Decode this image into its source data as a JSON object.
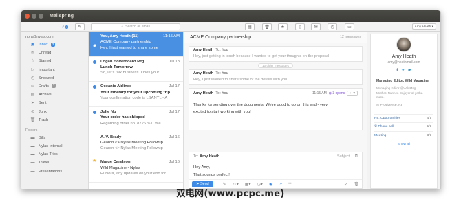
{
  "window": {
    "title": "Mailspring"
  },
  "toolbar": {
    "search_placeholder": "Search all email",
    "compose_badge": "1",
    "account_button": "Amy Heath"
  },
  "sidebar": {
    "account": "nora@nylas.com",
    "items": [
      {
        "label": "Inbox",
        "icon": "inbox-icon",
        "badge": "3",
        "active": true
      },
      {
        "label": "Unread",
        "icon": "unread-icon"
      },
      {
        "label": "Starred",
        "icon": "star-icon"
      },
      {
        "label": "Important",
        "icon": "important-icon"
      },
      {
        "label": "Snoozed",
        "icon": "clock-icon"
      },
      {
        "label": "Drafts",
        "icon": "draft-icon",
        "badge": "2"
      },
      {
        "label": "Archive",
        "icon": "archive-icon"
      },
      {
        "label": "Sent",
        "icon": "sent-icon"
      },
      {
        "label": "Junk",
        "icon": "junk-icon"
      },
      {
        "label": "Trash",
        "icon": "trash-icon"
      }
    ],
    "folders_label": "Folders",
    "folders": [
      "Bills",
      "Nylas-Internal",
      "Nylas Trips",
      "Travel",
      "Presentations"
    ]
  },
  "messages": [
    {
      "from": "You, Amy Heath (11)",
      "date": "11:15 AM",
      "subject": "ACME Company partnership",
      "snippet": "Hey, I just wanted to share some",
      "selected": true
    },
    {
      "from": "Logan Hoverboard Mfg.",
      "date": "Jul 18",
      "subject": "Lunch Tomorrow",
      "snippet": "So, let's talk business. Does your",
      "unread": true
    },
    {
      "from": "Oceanic Airlines",
      "date": "Jul 17",
      "subject": "Your itinerary for your upcoming trip",
      "snippet": "Your confirmation code is LSANYL - A",
      "unread": true
    },
    {
      "from": "Julie Ng",
      "date": "Jul 17",
      "subject": "Your order has shipped",
      "snippet": "Regarding order no. 8726761: We",
      "unread": true
    },
    {
      "from": "A. V. Brady",
      "date": "Jul 16",
      "subject": "Gearon <> Nylas Meeting Followup",
      "snippet": "Gearon <> Nylas Meeting Followup"
    },
    {
      "from": "Marge Carelson",
      "date": "Jul 16",
      "subject": "Wild Magazine - Nylas",
      "snippet": "Hi Nora, any updates on your end for",
      "starred": true
    }
  ],
  "thread": {
    "subject": "ACME Company partnership",
    "count": "12 messages",
    "first": {
      "from": "Amy Heath",
      "to": "To: You",
      "snippet": "Hey, just getting in touch because I wanted to get your thoughts on the proposal"
    },
    "older_label": "10 older messages",
    "second": {
      "from": "Amy Heath",
      "to": "To: You",
      "snippet": "Hey, I just wanted to share some of the details with you..."
    },
    "open": {
      "from": "Amy Heath",
      "to": "To: You",
      "time": "11:15 AM",
      "opens": "3 opens",
      "body1": "Thanks for sending over the documents. We're good to go on this end - very",
      "body2": "excited to start working with you!"
    }
  },
  "reply": {
    "to_label": "To:",
    "to": "Amy Heath",
    "subject_label": "Subject",
    "line1": "Hey Amy,",
    "line2": "That sounds perfect!",
    "send": "Send"
  },
  "contact": {
    "name": "Amy Heath",
    "email": "amy@heathmail.com",
    "title": "Managing Editor, Wild Magazine",
    "bio1": "Managing Editor @WildMag.",
    "bio2": "Mother. Runner. Enjoyer of yerba mate.",
    "location": "Providence, RI",
    "threads": [
      {
        "label": "Re: Opportunities",
        "value": "4/7"
      },
      {
        "label": "Phone call",
        "value": "5/7"
      },
      {
        "label": "Meeting",
        "value": "3/7"
      }
    ],
    "show_all": "Show all"
  },
  "watermark": "双电网(www.pcpc.me)",
  "colors": {
    "accent": "#3d8be6",
    "selected": "#4a90e2",
    "titlebar": "#3c3b37"
  }
}
